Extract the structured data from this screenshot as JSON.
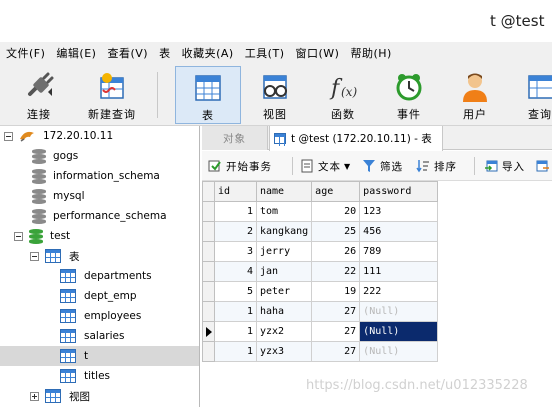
{
  "window": {
    "title": "t @test"
  },
  "menu": [
    "文件(F)",
    "编辑(E)",
    "查看(V)",
    "表",
    "收藏夹(A)",
    "工具(T)",
    "窗口(W)",
    "帮助(H)"
  ],
  "toolbar": {
    "connect": "连接",
    "new_query": "新建查询",
    "table": "表",
    "view": "视图",
    "function": "函数",
    "event": "事件",
    "user": "用户",
    "query": "查询"
  },
  "tree": {
    "connection": "172.20.10.11",
    "databases": [
      "gogs",
      "information_schema",
      "mysql",
      "performance_schema",
      "test"
    ],
    "tables_group": "表",
    "tables": [
      "departments",
      "dept_emp",
      "employees",
      "salaries",
      "t",
      "titles"
    ],
    "views_group": "视图"
  },
  "tabs": {
    "objects": "对象",
    "current": "t @test (172.20.10.11) - 表"
  },
  "subtoolbar": {
    "begin_tx": "开始事务",
    "text": "文本",
    "filter": "筛选",
    "sort": "排序",
    "import": "导入"
  },
  "grid": {
    "columns": [
      "id",
      "name",
      "age",
      "password"
    ],
    "rows": [
      [
        "1",
        "tom",
        "20",
        "123"
      ],
      [
        "2",
        "kangkang",
        "25",
        "456"
      ],
      [
        "3",
        "jerry",
        "26",
        "789"
      ],
      [
        "4",
        "jan",
        "22",
        "111"
      ],
      [
        "5",
        "peter",
        "19",
        "222"
      ],
      [
        "1",
        "haha",
        "27",
        "(Null)"
      ],
      [
        "1",
        "yzx2",
        "27",
        "(Null)"
      ],
      [
        "1",
        "yzx3",
        "27",
        "(Null)"
      ]
    ]
  },
  "watermark": "https://blog.csdn.net/u012335228",
  "colors": {
    "selection": "#0b2a6d",
    "accent": "#3b82d6"
  }
}
